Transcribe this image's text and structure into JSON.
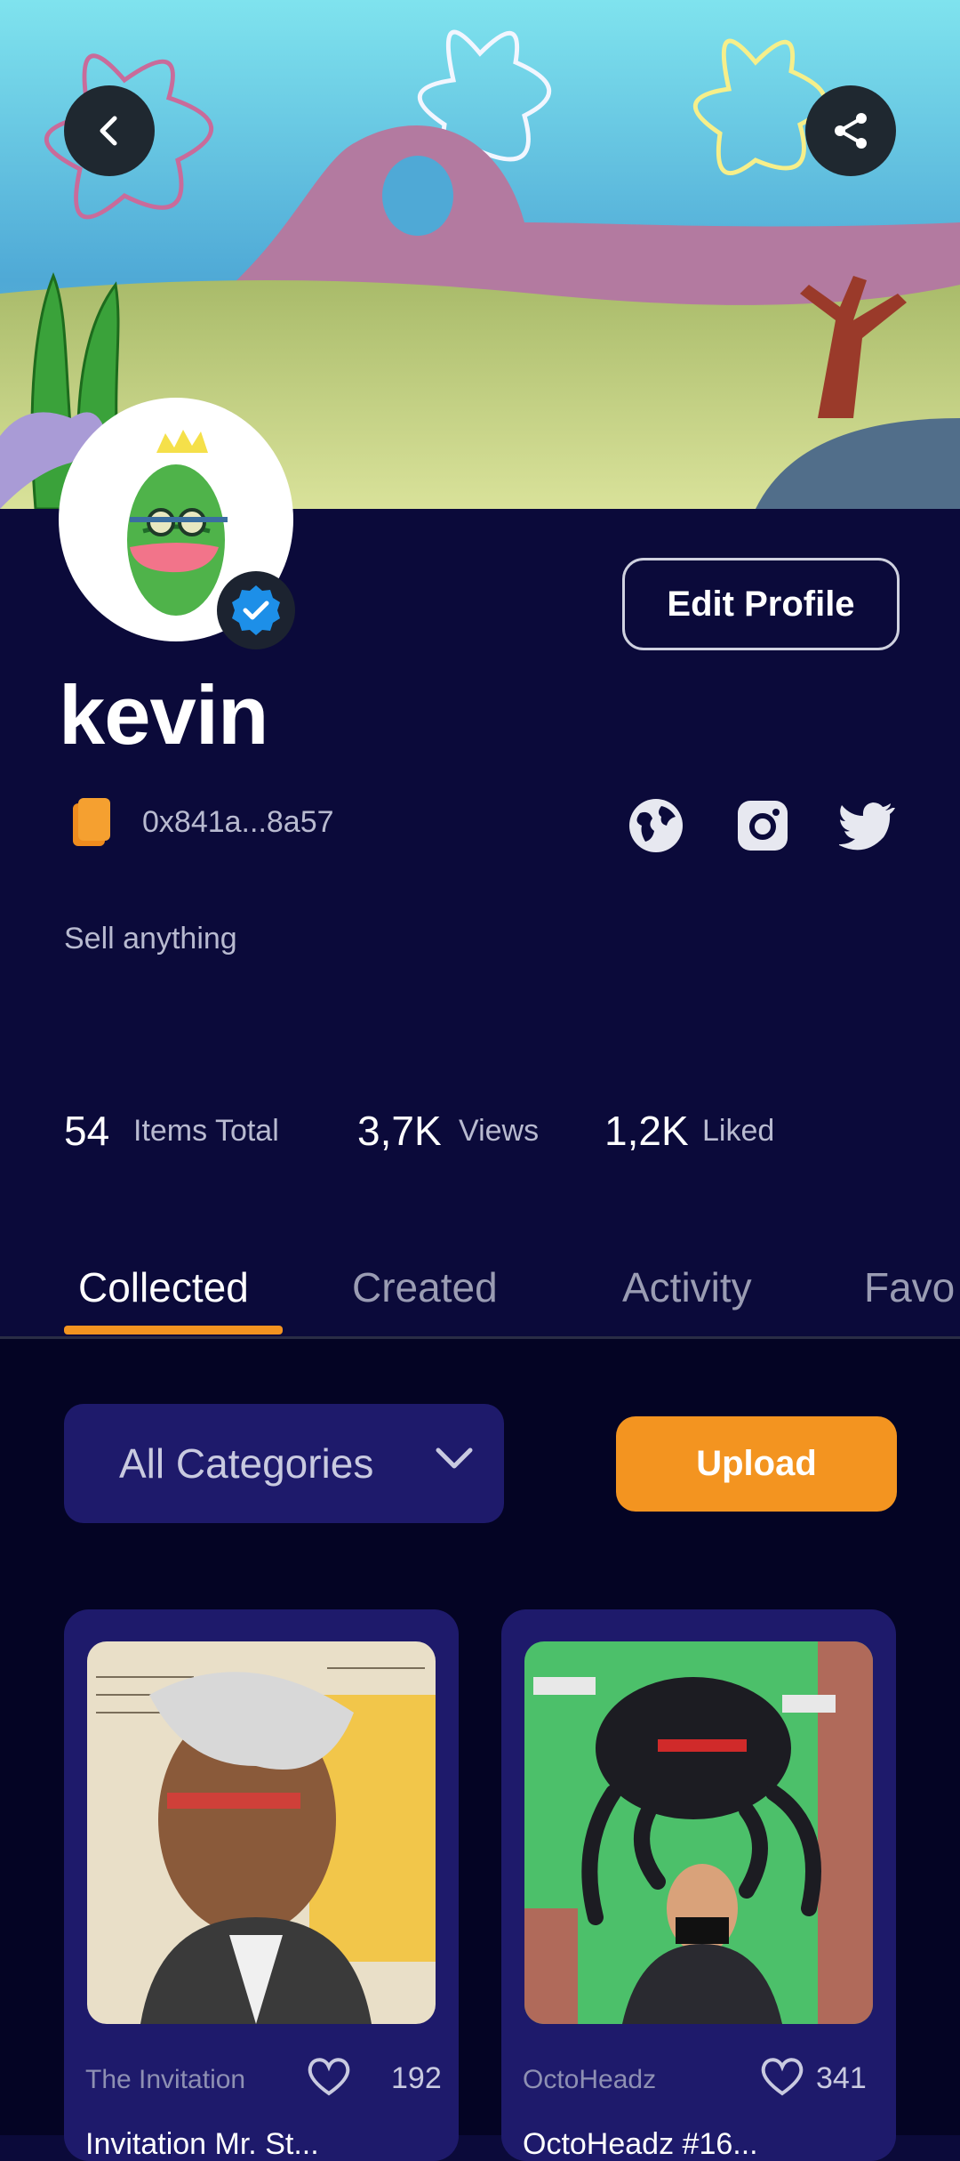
{
  "profile": {
    "username": "kevin",
    "wallet_address": "0x841a...8a57",
    "bio": "Sell anything",
    "edit_label": "Edit Profile",
    "verified": true
  },
  "stats": [
    {
      "value": "54",
      "label": "Items Total"
    },
    {
      "value": "3,7K",
      "label": "Views"
    },
    {
      "value": "1,2K",
      "label": "Liked"
    }
  ],
  "tabs": [
    {
      "label": "Collected",
      "active": true
    },
    {
      "label": "Created",
      "active": false
    },
    {
      "label": "Activity",
      "active": false
    },
    {
      "label": "Favo",
      "active": false
    }
  ],
  "filters": {
    "category_selected": "All Categories",
    "upload_label": "Upload"
  },
  "items": [
    {
      "collection": "The Invitation",
      "likes": "192",
      "name": "Invitation Mr. St..."
    },
    {
      "collection": "OctoHeadz",
      "likes": "341",
      "name": "OctoHeadz #16..."
    }
  ],
  "colors": {
    "background": "#0b0a3a",
    "content_background": "#040424",
    "card_background": "#1e1a6b",
    "accent": "#f39420",
    "verified": "#1d8fe8"
  },
  "icons": [
    "back-arrow-icon",
    "share-icon",
    "verified-badge-icon",
    "wallet-icon",
    "globe-icon",
    "instagram-icon",
    "twitter-icon",
    "chevron-down-icon",
    "heart-icon"
  ]
}
